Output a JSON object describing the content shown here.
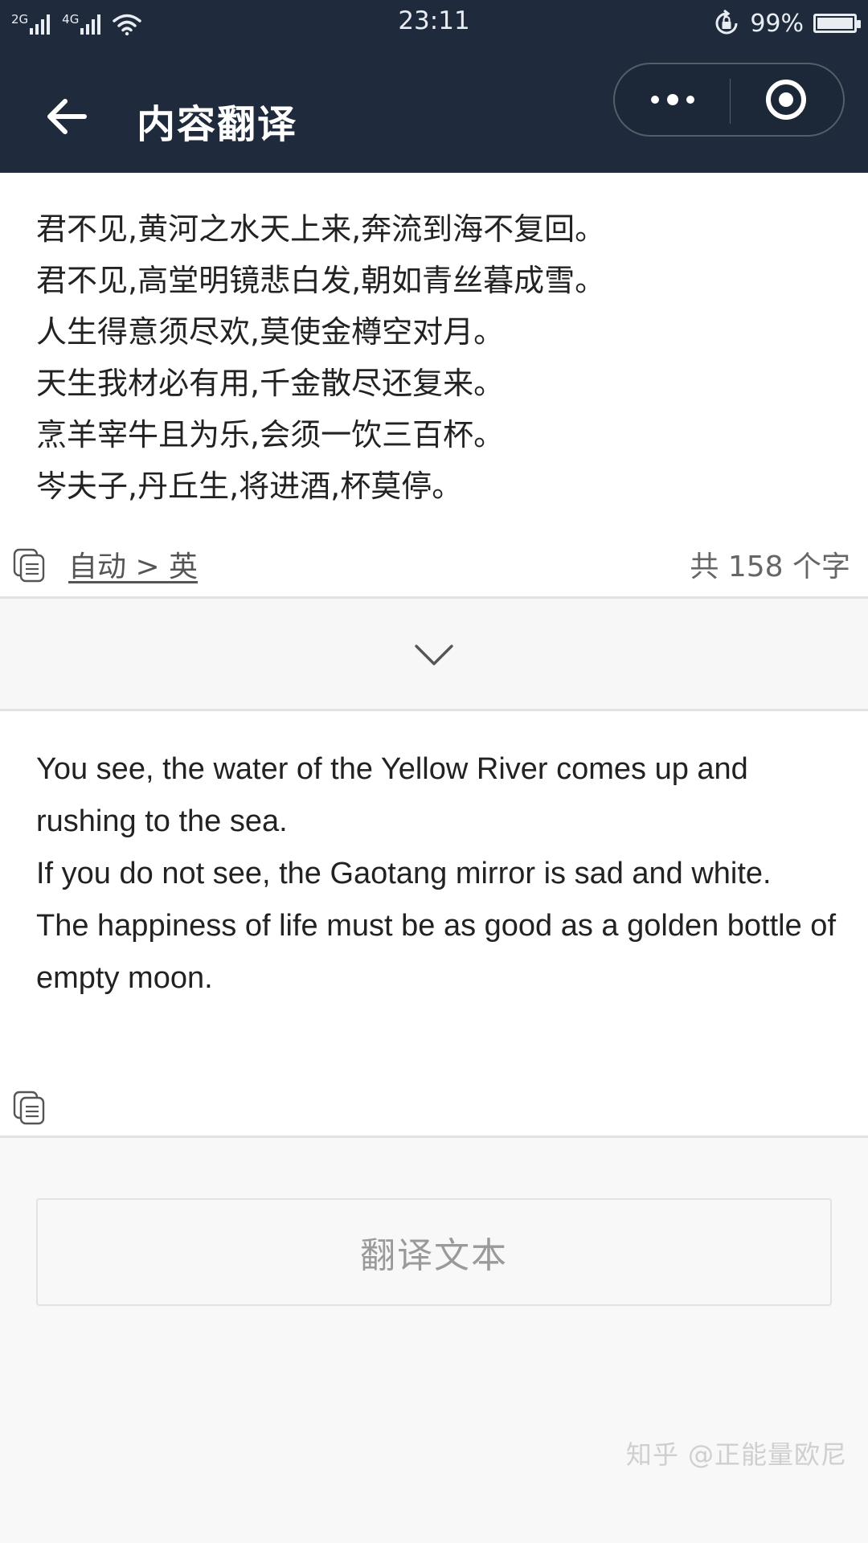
{
  "status_bar": {
    "network_1": "2G",
    "network_2": "4G",
    "time": "23:11",
    "battery": "99%",
    "battery_level": 0.99
  },
  "header": {
    "title": "内容翻译"
  },
  "source": {
    "lines": [
      "君不见,黄河之水天上来,奔流到海不复回。",
      "君不见,高堂明镜悲白发,朝如青丝暮成雪。",
      "人生得意须尽欢,莫使金樽空对月。",
      "天生我材必有用,千金散尽还复来。",
      "烹羊宰牛且为乐,会须一饮三百杯。",
      "岑夫子,丹丘生,将进酒,杯莫停。"
    ],
    "language_pair": "自动 > 英",
    "char_count": "共 158 个字"
  },
  "result": {
    "lines": [
      "You see, the water of the Yellow River comes up and rushing to the sea.",
      "If you do not see, the Gaotang mirror is sad and white.",
      "The happiness of life must be as good as a golden bottle of empty moon."
    ]
  },
  "translate_button": {
    "label": "翻译文本"
  },
  "watermark": "知乎 @正能量欧尼",
  "colors": {
    "header_bg": "#1f2b3c",
    "page_bg": "#f8f8f8"
  }
}
